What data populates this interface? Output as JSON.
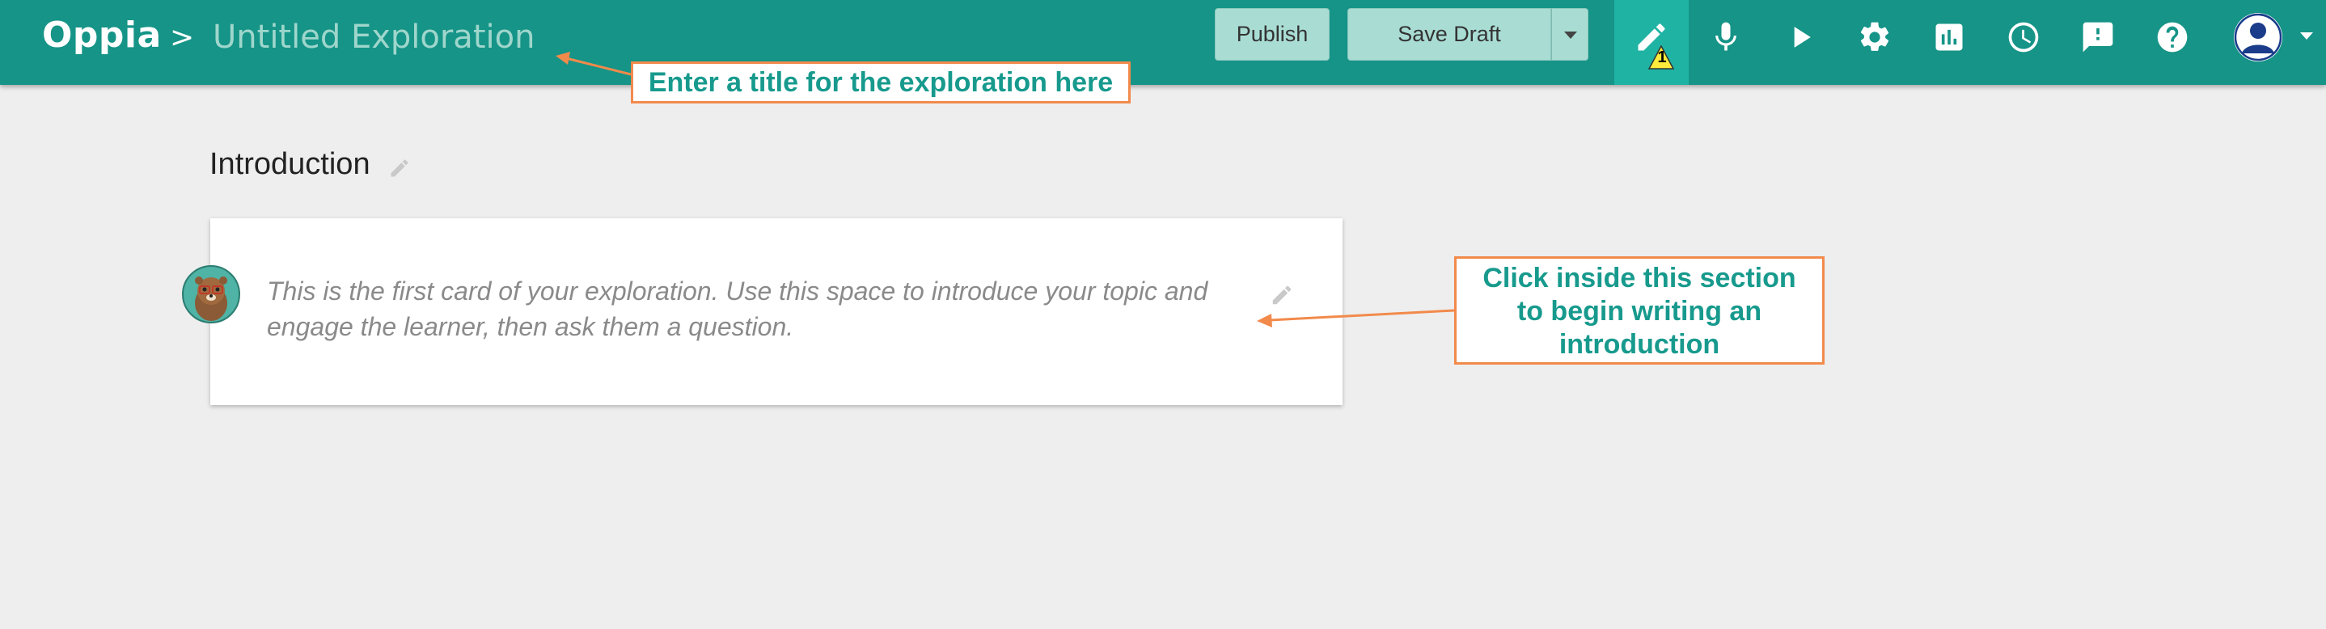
{
  "header": {
    "logo": "Oppia",
    "separator": ">",
    "title_placeholder": "Untitled Exploration",
    "publish_label": "Publish",
    "save_label": "Save Draft",
    "warning_count": "1",
    "nav_icons": [
      "pencil-icon",
      "microphone-icon",
      "play-icon",
      "gear-icon",
      "bar-chart-icon",
      "clock-icon",
      "feedback-icon",
      "help-icon"
    ],
    "colors": {
      "bar": "#159487",
      "active_tab": "#1fb3a4",
      "button": "#a9ddd4"
    }
  },
  "annotations": {
    "title_hint": "Enter a title for the exploration here",
    "intro_hint_lines": [
      "Click inside this section",
      "to begin writing an",
      "introduction"
    ],
    "colors": {
      "border": "#f28a4b",
      "text": "#179a8d"
    }
  },
  "state": {
    "name": "Introduction",
    "content_lines": [
      "This is the first card of your exploration. Use this space to introduce your topic and",
      "engage the learner, then ask them a question."
    ]
  }
}
